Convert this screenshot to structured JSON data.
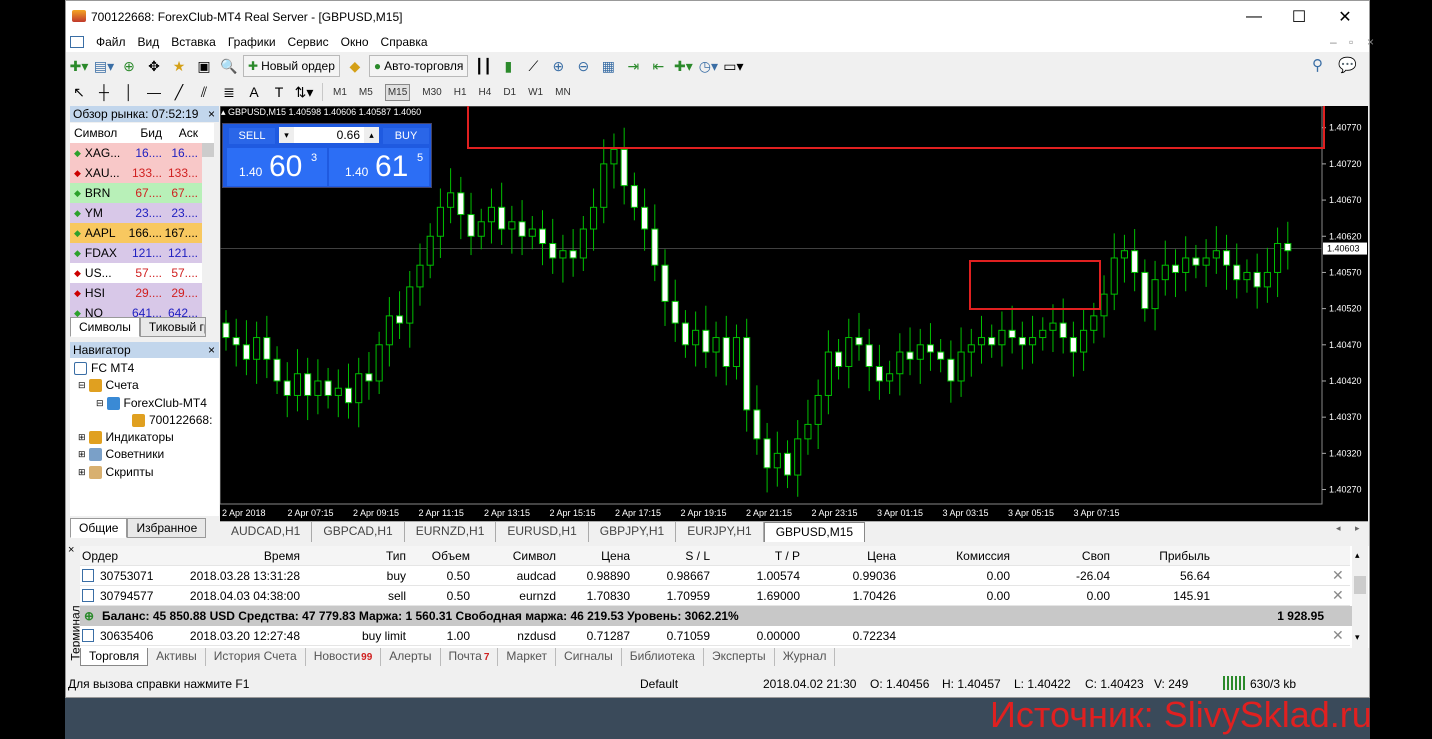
{
  "window": {
    "title": "700122668: ForexClub-MT4 Real Server - [GBPUSD,M15]",
    "minimize": "—",
    "maximize": "☐",
    "close": "✕"
  },
  "menu": [
    "Файл",
    "Вид",
    "Вставка",
    "Графики",
    "Сервис",
    "Окно",
    "Справка"
  ],
  "toolbar": {
    "new_order": "Новый ордер",
    "auto_trading": "Авто-торговля"
  },
  "timeframes": [
    "M1",
    "M5",
    "M15",
    "M30",
    "H1",
    "H4",
    "D1",
    "W1",
    "MN"
  ],
  "market_watch": {
    "title": "Обзор рынка: 07:52:19",
    "cols": [
      "Символ",
      "Бид",
      "Аск"
    ],
    "rows": [
      {
        "sym": "XAG...",
        "bid": "16....",
        "ask": "16....",
        "dir": "up",
        "bg": "#f8c8c8",
        "color": "#2020c0"
      },
      {
        "sym": "XAU...",
        "bid": "133...",
        "ask": "133...",
        "dir": "down",
        "bg": "#f8c8c8",
        "color": "#d02020"
      },
      {
        "sym": "BRN",
        "bid": "67....",
        "ask": "67....",
        "dir": "up",
        "bg": "#b8f0b8",
        "color": "#d02020"
      },
      {
        "sym": "YM",
        "bid": "23....",
        "ask": "23....",
        "dir": "up",
        "bg": "#d8c8e8",
        "color": "#2020c0"
      },
      {
        "sym": "AAPL",
        "bid": "166....",
        "ask": "167....",
        "dir": "up",
        "bg": "#f8c860",
        "color": "#000000"
      },
      {
        "sym": "FDAX",
        "bid": "121...",
        "ask": "121...",
        "dir": "up",
        "bg": "#d8c8e8",
        "color": "#2020c0"
      },
      {
        "sym": "US...",
        "bid": "57....",
        "ask": "57....",
        "dir": "down",
        "bg": "#ffffff",
        "color": "#d02020"
      },
      {
        "sym": "HSI",
        "bid": "29....",
        "ask": "29....",
        "dir": "down",
        "bg": "#d8c8e8",
        "color": "#d02020"
      },
      {
        "sym": "NQ",
        "bid": "641...",
        "ask": "642...",
        "dir": "up",
        "bg": "#d8c8e8",
        "color": "#2020c0"
      }
    ],
    "tabs": [
      "Символы",
      "Тиковый гр"
    ]
  },
  "navigator": {
    "title": "Навигатор",
    "items": [
      "FC MT4",
      "Счета",
      "ForexClub-MT4",
      "700122668:",
      "Индикаторы",
      "Советники",
      "Скрипты"
    ],
    "tabs": [
      "Общие",
      "Избранное"
    ]
  },
  "chart": {
    "label": "GBPUSD,M15  1.40598 1.40606 1.40587 1.4060",
    "sell": "SELL",
    "buy": "BUY",
    "volume": "0.66",
    "sell_prefix": "1.40",
    "sell_big": "60",
    "sell_sup": "3",
    "buy_prefix": "1.40",
    "buy_big": "61",
    "buy_sup": "5",
    "current_price": "1.40603",
    "price_labels": [
      "1.40770",
      "1.40720",
      "1.40670",
      "1.40620",
      "1.40570",
      "1.40520",
      "1.40470",
      "1.40420",
      "1.40370",
      "1.40320",
      "1.40270"
    ],
    "time_labels": [
      "2 Apr 2018",
      "2 Apr 07:15",
      "2 Apr 09:15",
      "2 Apr 11:15",
      "2 Apr 13:15",
      "2 Apr 15:15",
      "2 Apr 17:15",
      "2 Apr 19:15",
      "2 Apr 21:15",
      "2 Apr 23:15",
      "3 Apr 01:15",
      "3 Apr 03:15",
      "3 Apr 05:15",
      "3 Apr 07:15"
    ],
    "tabs": [
      "AUDCAD,H1",
      "GBPCAD,H1",
      "EURNZD,H1",
      "EURUSD,H1",
      "GBPJPY,H1",
      "EURJPY,H1",
      "GBPUSD,M15"
    ]
  },
  "chart_data": {
    "type": "candlestick",
    "symbol": "GBPUSD",
    "timeframe": "M15",
    "ylim": [
      1.4025,
      1.408
    ],
    "current_price": 1.40603,
    "closes": [
      1.4048,
      1.4047,
      1.4045,
      1.4048,
      1.4045,
      1.4042,
      1.404,
      1.4043,
      1.404,
      1.4042,
      1.404,
      1.4041,
      1.4039,
      1.4043,
      1.4042,
      1.4047,
      1.4051,
      1.405,
      1.4055,
      1.4058,
      1.4062,
      1.4066,
      1.4068,
      1.4065,
      1.4062,
      1.4064,
      1.4066,
      1.4063,
      1.4064,
      1.4062,
      1.4063,
      1.4061,
      1.4059,
      1.406,
      1.4059,
      1.4063,
      1.4066,
      1.4072,
      1.4074,
      1.4069,
      1.4066,
      1.4063,
      1.4058,
      1.4053,
      1.405,
      1.4047,
      1.4049,
      1.4046,
      1.4048,
      1.4044,
      1.4048,
      1.4038,
      1.4034,
      1.403,
      1.4032,
      1.4029,
      1.4034,
      1.4036,
      1.404,
      1.4046,
      1.4044,
      1.4048,
      1.4047,
      1.4044,
      1.4042,
      1.4043,
      1.4046,
      1.4045,
      1.4047,
      1.4046,
      1.4045,
      1.4042,
      1.4046,
      1.4047,
      1.4048,
      1.4047,
      1.4049,
      1.4048,
      1.4047,
      1.4048,
      1.4049,
      1.405,
      1.4048,
      1.4046,
      1.4049,
      1.4051,
      1.4054,
      1.4059,
      1.406,
      1.4057,
      1.4052,
      1.4056,
      1.4058,
      1.4057,
      1.4059,
      1.4058,
      1.4059,
      1.406,
      1.4058,
      1.4056,
      1.4057,
      1.4055,
      1.4057,
      1.4061,
      1.406
    ]
  },
  "terminal": {
    "side_label": "Терминал",
    "cols": [
      "Ордер",
      "Время",
      "Тип",
      "Объем",
      "Символ",
      "Цена",
      "S / L",
      "T / P",
      "Цена",
      "Комиссия",
      "Своп",
      "Прибыль"
    ],
    "rows": [
      [
        "30753071",
        "2018.03.28 13:31:28",
        "buy",
        "0.50",
        "audcad",
        "0.98890",
        "0.98667",
        "1.00574",
        "0.99036",
        "0.00",
        "-26.04",
        "56.64"
      ],
      [
        "30794577",
        "2018.04.03 04:38:00",
        "sell",
        "0.50",
        "eurnzd",
        "1.70830",
        "1.70959",
        "1.69000",
        "1.70426",
        "0.00",
        "0.00",
        "145.91"
      ]
    ],
    "balance_line": "Баланс: 45 850.88 USD  Средства: 47 779.83  Маржа: 1 560.31  Свободная маржа: 46 219.53  Уровень: 3062.21%",
    "balance_total": "1 928.95",
    "pending": [
      "30635406",
      "2018.03.20 12:27:48",
      "buy limit",
      "1.00",
      "nzdusd",
      "0.71287",
      "0.71059",
      "0.00000",
      "0.72234"
    ],
    "tabs": [
      "Торговля",
      "Активы",
      "История Счета",
      "Новости",
      "Алерты",
      "Почта",
      "Маркет",
      "Сигналы",
      "Библиотека",
      "Эксперты",
      "Журнал"
    ],
    "news_count": "99",
    "mail_count": "7"
  },
  "status": {
    "help": "Для вызова справки нажмите F1",
    "profile": "Default",
    "time": "2018.04.02 21:30",
    "open": "O: 1.40456",
    "high": "H: 1.40457",
    "low": "L: 1.40422",
    "close": "C: 1.40423",
    "volume": "V: 249",
    "traffic": "630/3 kb"
  },
  "watermark": "Источник: SlivySklad.ru"
}
